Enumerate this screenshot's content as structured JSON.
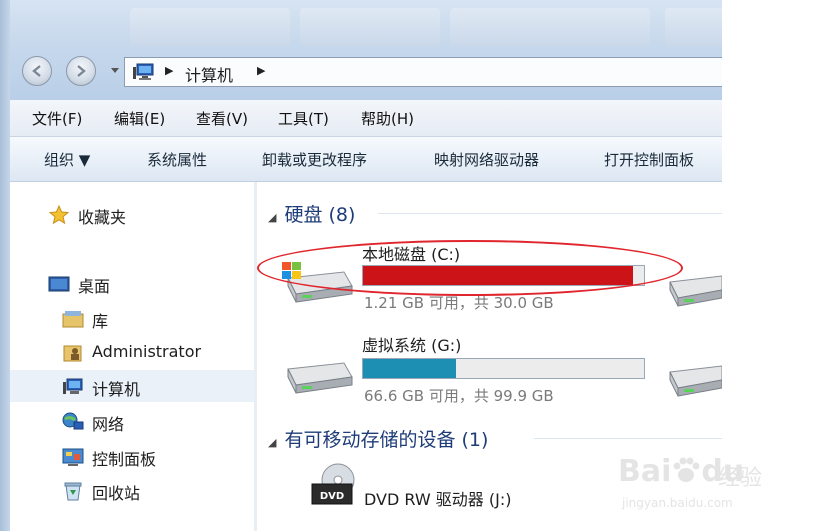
{
  "address_bar": {
    "crumb": "计算机"
  },
  "menubar": {
    "items": [
      "文件(F)",
      "编辑(E)",
      "查看(V)",
      "工具(T)",
      "帮助(H)"
    ]
  },
  "toolbar": {
    "organize": "组织 ▼",
    "system_properties": "系统属性",
    "uninstall": "卸载或更改程序",
    "map_drive": "映射网络驱动器",
    "control_panel": "打开控制面板"
  },
  "nav": {
    "favorites": "收藏夹",
    "desktop": "桌面",
    "libraries": "库",
    "administrator": "Administrator",
    "computer": "计算机",
    "network": "网络",
    "control_panel": "控制面板",
    "recycle_bin": "回收站"
  },
  "content": {
    "hard_disks_group": "硬盘 (8)",
    "removable_group": "有可移动存储的设备 (1)",
    "drives": [
      {
        "name": "本地磁盘 (C:)",
        "info": "1.21 GB 可用，共 30.0 GB",
        "used_fraction": 0.96,
        "bar_color": "#cc1418"
      },
      {
        "name": "虚拟系统 (G:)",
        "info": "66.6 GB 可用，共 99.9 GB",
        "used_fraction": 0.33,
        "bar_color": "#1d8fb3"
      }
    ],
    "dvd": {
      "name": "DVD RW 驱动器 (J:)",
      "badge": "DVD"
    }
  },
  "watermark": {
    "brand": "Bai",
    "brand2": "du",
    "cn": "经验",
    "url": "jingyan.baidu.com"
  },
  "colors": {
    "highlight_ellipse": "#e0262c",
    "group_heading": "#1e3c78"
  }
}
